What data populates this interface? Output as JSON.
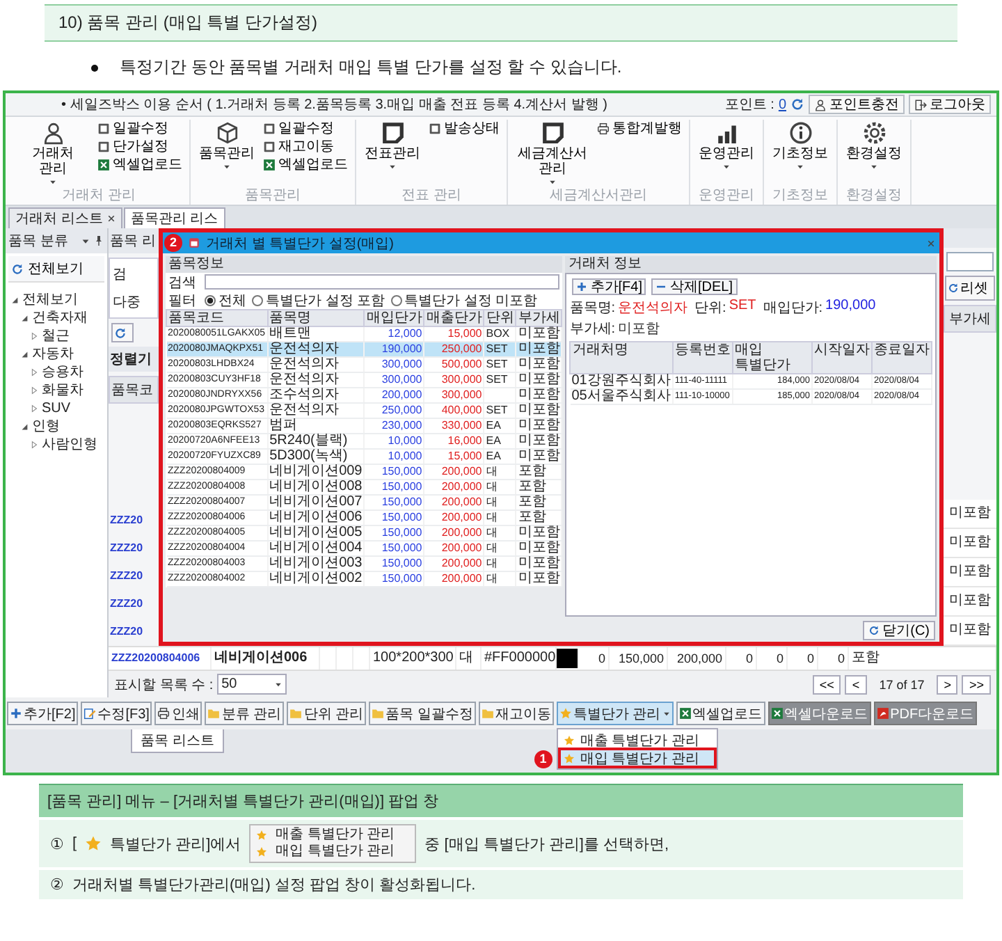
{
  "heading": "10) 품목 관리 (매입 특별 단가설정)",
  "bullet": "특정기간 동안 품목별 거래처 매입 특별 단가를 설정 할 수 있습니다.",
  "app": {
    "banner": "• 세일즈박스 이용 순서 ( 1.거래처 등록 2.품목등록 3.매입 매출 전표 등록 4.계산서 발행 )",
    "points_label": "포인트 :",
    "points_value": "0",
    "top_buttons": [
      {
        "label": "포인트충전",
        "kind": "charge"
      },
      {
        "label": "로그아웃",
        "kind": "logout"
      }
    ],
    "ribbon": [
      {
        "label": "거래처 관리",
        "main": "거래처 관리",
        "kind": "partners",
        "small": [
          {
            "text": "일괄수정",
            "kind": "edit"
          },
          {
            "text": "단가설정",
            "kind": "edit"
          },
          {
            "text": "엑셀업로드",
            "kind": "upload"
          }
        ]
      },
      {
        "label": "품목관리",
        "main": "품목관리",
        "kind": "items",
        "small": [
          {
            "text": "일괄수정",
            "kind": "edit"
          },
          {
            "text": "재고이동",
            "kind": "edit"
          },
          {
            "text": "엑셀업로드",
            "kind": "upload"
          }
        ]
      },
      {
        "label": "전표 관리",
        "main": "전표관리",
        "kind": "slips",
        "small": [
          {
            "text": "발송상태",
            "kind": "edit"
          }
        ]
      },
      {
        "label": "세금계산서관리",
        "main": "세금계산서 관리",
        "kind": "slips",
        "small": [
          {
            "text": "통합계발행",
            "kind": "issue"
          }
        ]
      },
      {
        "label": "운영관리",
        "main": "운영관리",
        "kind": "operations"
      },
      {
        "label": "기초정보",
        "main": "기초정보",
        "kind": "basics"
      },
      {
        "label": "환경설정",
        "main": "환경설정",
        "kind": "settings"
      }
    ],
    "tabs": [
      {
        "label": "거래처 리스트",
        "selected": false,
        "closable": true
      },
      {
        "label": "품목관리 리스",
        "selected": true,
        "closable": false
      }
    ],
    "category_panel": {
      "title": "품목 분류",
      "show_all": "전체보기",
      "tree": [
        {
          "label": "전체보기",
          "expanded": true,
          "children": [
            {
              "label": "건축자재",
              "expanded": true,
              "children": [
                {
                  "label": "철근",
                  "expanded": false
                }
              ]
            },
            {
              "label": "자동차",
              "expanded": true,
              "children": [
                {
                  "label": "승용차",
                  "expanded": false
                },
                {
                  "label": "화물차",
                  "expanded": false
                },
                {
                  "label": "SUV",
                  "expanded": false
                }
              ]
            },
            {
              "label": "인형",
              "expanded": true,
              "children": [
                {
                  "label": "사람인형",
                  "expanded": false
                }
              ]
            }
          ]
        }
      ]
    },
    "list_left_edge": {
      "title": "품목 리",
      "search_label": "검",
      "multi_label": "다중",
      "sort_label": "정렬기",
      "column": "품목코",
      "codes": [
        "ZZZ20",
        "ZZZ20",
        "ZZZ20",
        "ZZZ20",
        "ZZZ20"
      ]
    },
    "list_right_edge": {
      "reset": "리셋",
      "column": "부가세",
      "cells": [
        "미포함",
        "미포함",
        "미포함",
        "미포함",
        "미포함"
      ]
    },
    "last_row": [
      {
        "kind": "link",
        "text": "ZZZ20200804006"
      },
      {
        "kind": "bold",
        "text": "네비게이션006"
      },
      {
        "kind": "blank"
      },
      {
        "kind": "blank"
      },
      {
        "kind": "blank"
      },
      {
        "kind": "text",
        "text": "100*200*300"
      },
      {
        "kind": "text",
        "text": "대"
      },
      {
        "kind": "text",
        "text": "#FF000000"
      },
      {
        "kind": "swatch",
        "color": "#000000"
      },
      {
        "kind": "num",
        "text": "0"
      },
      {
        "kind": "num",
        "text": "150,000"
      },
      {
        "kind": "num",
        "text": "200,000"
      },
      {
        "kind": "num",
        "text": "0"
      },
      {
        "kind": "num",
        "text": "0"
      },
      {
        "kind": "num",
        "text": "0"
      },
      {
        "kind": "num",
        "text": "0"
      },
      {
        "kind": "text",
        "text": "포함"
      }
    ],
    "pager": {
      "label": "표시할 목록 수 :",
      "page_size": "50",
      "nav_back": [
        "<<",
        "<"
      ],
      "page": "17 of 17",
      "nav_forward": [
        ">",
        ">>"
      ]
    },
    "buttons": [
      {
        "label": "추가[F2]",
        "kind": "add"
      },
      {
        "label": "수정[F3]",
        "kind": "edit"
      },
      {
        "label": "인쇄",
        "kind": "print"
      },
      {
        "label": "분류 관리",
        "kind": "manage"
      },
      {
        "label": "단위 관리",
        "kind": "manage"
      },
      {
        "label": "품목 일괄수정",
        "kind": "manage"
      },
      {
        "label": "재고이동",
        "kind": "manage"
      },
      {
        "label": "특별단가 관리",
        "kind": "menu"
      },
      {
        "label": "엑셀업로드",
        "kind": "upload"
      },
      {
        "label": "엑셀다운로드",
        "kind": "download"
      },
      {
        "label": "PDF다운로드",
        "kind": "pdf"
      }
    ],
    "menu": [
      {
        "label": "매출 특별단가 관리",
        "selected": false
      },
      {
        "label": "매입 특별단가 관리",
        "selected": true
      }
    ],
    "menu_marker": "1",
    "bottom_tab": "품목 리스트",
    "popup": {
      "marker": "2",
      "title": "거래처 별 특별단가 설정(매입)",
      "items_section": "품목정보",
      "search_label": "검색",
      "filter_label": "필터",
      "filters": [
        {
          "label": "전체",
          "selected": true
        },
        {
          "label": "특별단가 설정 포함",
          "selected": false
        },
        {
          "label": "특별단가 설정 미포함",
          "selected": false
        }
      ],
      "columns": [
        "품목코드",
        "품목명",
        "매입단가",
        "매출단가",
        "단위",
        "부가세"
      ],
      "rows": [
        {
          "code": "2020080051LGAKX05",
          "name": "배트맨",
          "buy": "12,000",
          "sell": "15,000",
          "unit": "BOX",
          "vat": "미포함",
          "selected": false
        },
        {
          "code": "2020080JMAQKPX51",
          "name": "운전석의자",
          "buy": "190,000",
          "sell": "250,000",
          "unit": "SET",
          "vat": "미포함",
          "selected": true
        },
        {
          "code": "20200803LHDBX24",
          "name": "운전석의자",
          "buy": "300,000",
          "sell": "500,000",
          "unit": "SET",
          "vat": "미포함",
          "selected": false
        },
        {
          "code": "20200803CUY3HF18",
          "name": "운전석의자",
          "buy": "300,000",
          "sell": "300,000",
          "unit": "SET",
          "vat": "미포함",
          "selected": false
        },
        {
          "code": "2020080JNDRYXX56",
          "name": "조수석의자",
          "buy": "200,000",
          "sell": "300,000",
          "vat": "미포함",
          "selected": false
        },
        {
          "code": "2020080JPGWTOX53",
          "name": "운전석의자",
          "buy": "250,000",
          "sell": "400,000",
          "unit": "SET",
          "vat": "미포함",
          "selected": false
        },
        {
          "code": "20200803EQRKS527",
          "name": "범퍼",
          "buy": "230,000",
          "sell": "330,000",
          "unit": "EA",
          "vat": "미포함",
          "selected": false
        },
        {
          "code": "20200720A6NFEE13",
          "name": "5R240(블랙)",
          "buy": "10,000",
          "sell": "16,000",
          "unit": "EA",
          "vat": "미포함",
          "selected": false
        },
        {
          "code": "20200720FYUZXC89",
          "name": "5D300(녹색)",
          "buy": "10,000",
          "sell": "15,000",
          "unit": "EA",
          "vat": "미포함",
          "selected": false
        },
        {
          "code": "ZZZ20200804009",
          "name": "네비게이션009",
          "buy": "150,000",
          "sell": "200,000",
          "unit": "대",
          "vat": "포함",
          "selected": false
        },
        {
          "code": "ZZZ20200804008",
          "name": "네비게이션008",
          "buy": "150,000",
          "sell": "200,000",
          "unit": "대",
          "vat": "포함",
          "selected": false
        },
        {
          "code": "ZZZ20200804007",
          "name": "네비게이션007",
          "buy": "150,000",
          "sell": "200,000",
          "unit": "대",
          "vat": "포함",
          "selected": false
        },
        {
          "code": "ZZZ20200804006",
          "name": "네비게이션006",
          "buy": "150,000",
          "sell": "200,000",
          "unit": "대",
          "vat": "포함",
          "selected": false
        },
        {
          "code": "ZZZ20200804005",
          "name": "네비게이션005",
          "buy": "150,000",
          "sell": "200,000",
          "unit": "대",
          "vat": "미포함",
          "selected": false
        },
        {
          "code": "ZZZ20200804004",
          "name": "네비게이션004",
          "buy": "150,000",
          "sell": "200,000",
          "unit": "대",
          "vat": "미포함",
          "selected": false
        },
        {
          "code": "ZZZ20200804003",
          "name": "네비게이션003",
          "buy": "150,000",
          "sell": "200,000",
          "unit": "대",
          "vat": "미포함",
          "selected": false
        },
        {
          "code": "ZZZ20200804002",
          "name": "네비게이션002",
          "buy": "150,000",
          "sell": "200,000",
          "unit": "대",
          "vat": "미포함",
          "selected": false
        }
      ],
      "partner_section": "거래처 정보",
      "partner_buttons": [
        {
          "label": "추가[F4]",
          "kind": "add"
        },
        {
          "label": "삭제[DEL]",
          "kind": "delete"
        }
      ],
      "info": [
        {
          "label": "품목명:",
          "value": "운전석의자",
          "color": "#e02020"
        },
        {
          "label": "단위:",
          "value": "SET",
          "color": "#e02020"
        },
        {
          "label": "매입단가:",
          "value": "190,000",
          "color": "#2020e0"
        },
        {
          "label": "부가세:",
          "value": "미포함",
          "color": "#333333"
        }
      ],
      "partner_columns": [
        "거래처명",
        "등록번호",
        "매입 특별단가",
        "시작일자",
        "종료일자"
      ],
      "partners": [
        {
          "name": "01강원주식회사",
          "reg": "111-40-11111",
          "price": "184,000",
          "start": "2020/08/04",
          "end": "2020/08/04"
        },
        {
          "name": "05서울주식회사",
          "reg": "111-10-10000",
          "price": "185,000",
          "start": "2020/08/04",
          "end": "2020/08/04"
        }
      ],
      "close": "닫기(C)"
    }
  },
  "note": {
    "title": "[품목 관리] 메뉴 – [거래처별 특별단가 관리(매입)] 팝업 창",
    "step1": {
      "num": "①",
      "open": "[",
      "text": "특별단가 관리]에서",
      "menu": [
        "매출 특별단가 관리",
        "매입 특별단가 관리"
      ],
      "after": "중 [매입 특별단가 관리]를 선택하면,"
    },
    "step2": {
      "num": "②",
      "text": "거래처별 특별단가관리(매입) 설정 팝업 창이 활성화됩니다."
    }
  }
}
